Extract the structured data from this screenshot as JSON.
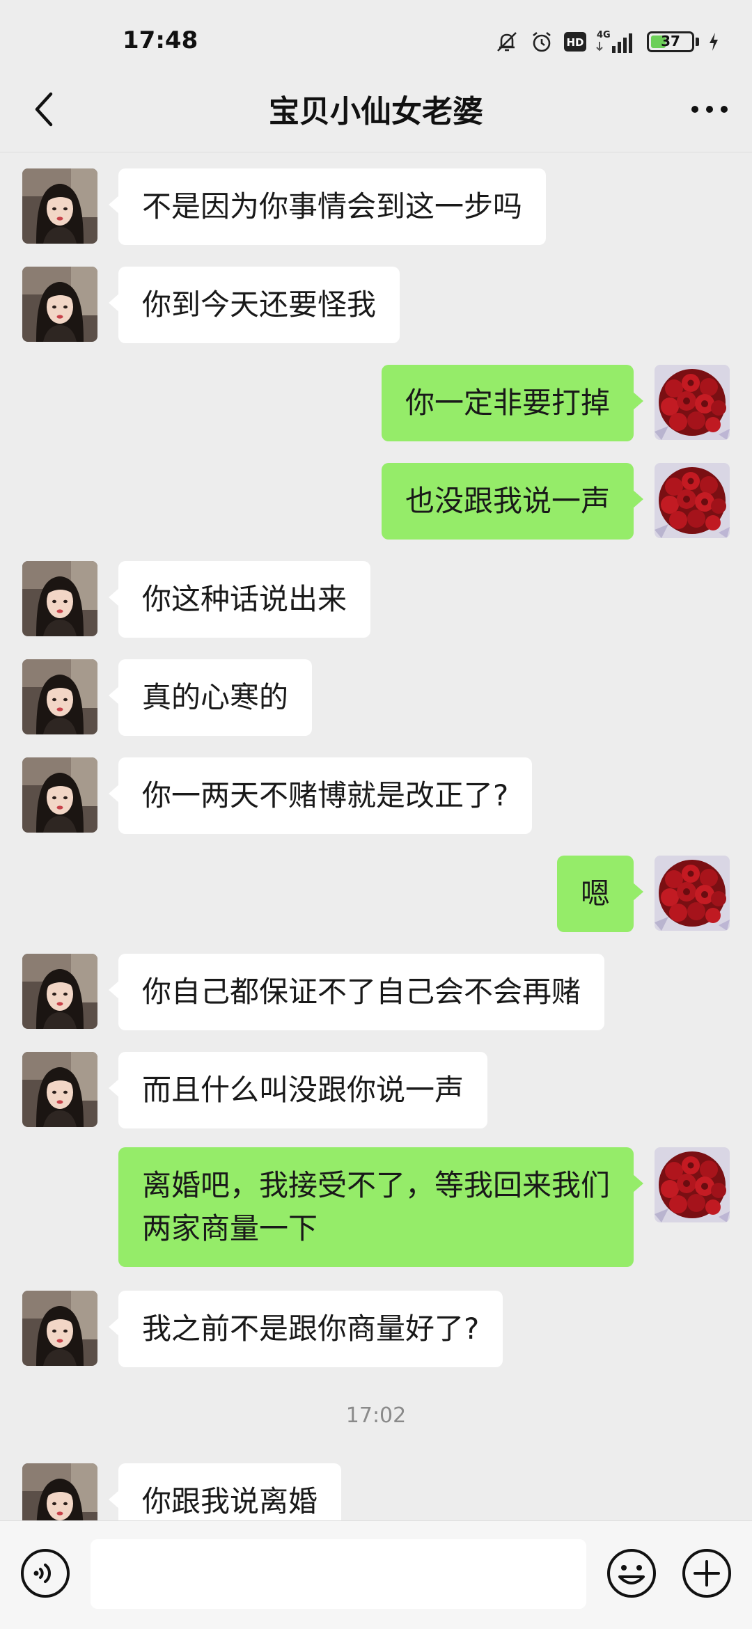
{
  "status_bar": {
    "time": "17:48",
    "network": "4G",
    "hd": "HD",
    "battery_level": "37",
    "battery_fraction": 0.37
  },
  "header": {
    "title": "宝贝小仙女老婆",
    "back_icon": "chevron-left-icon",
    "more_icon": "more-dots-icon"
  },
  "colors": {
    "outgoing_bubble": "#95ec69",
    "incoming_bubble": "#ffffff",
    "background": "#ededed"
  },
  "messages": [
    {
      "from": "contact",
      "text": "不是因为你事情会到这一步吗"
    },
    {
      "from": "contact",
      "text": "你到今天还要怪我"
    },
    {
      "from": "me",
      "text": "你一定非要打掉"
    },
    {
      "from": "me",
      "text": "也没跟我说一声"
    },
    {
      "from": "contact",
      "text": "你这种话说出来"
    },
    {
      "from": "contact",
      "text": "真的心寒的"
    },
    {
      "from": "contact",
      "text": "你一两天不赌博就是改正了?"
    },
    {
      "from": "me",
      "text": "嗯"
    },
    {
      "from": "contact",
      "text": "你自己都保证不了自己会不会再赌"
    },
    {
      "from": "contact",
      "text": "而且什么叫没跟你说一声"
    },
    {
      "from": "me",
      "text": "离婚吧，我接受不了，等我回来我们两家商量一下"
    },
    {
      "from": "contact",
      "text": "我之前不是跟你商量好了?"
    },
    {
      "from": "contact",
      "text": "你跟我说离婚"
    }
  ],
  "time_divider": "17:02",
  "input_bar": {
    "voice_icon": "voice-icon",
    "emoji_icon": "emoji-icon",
    "plus_icon": "plus-icon",
    "value": ""
  }
}
